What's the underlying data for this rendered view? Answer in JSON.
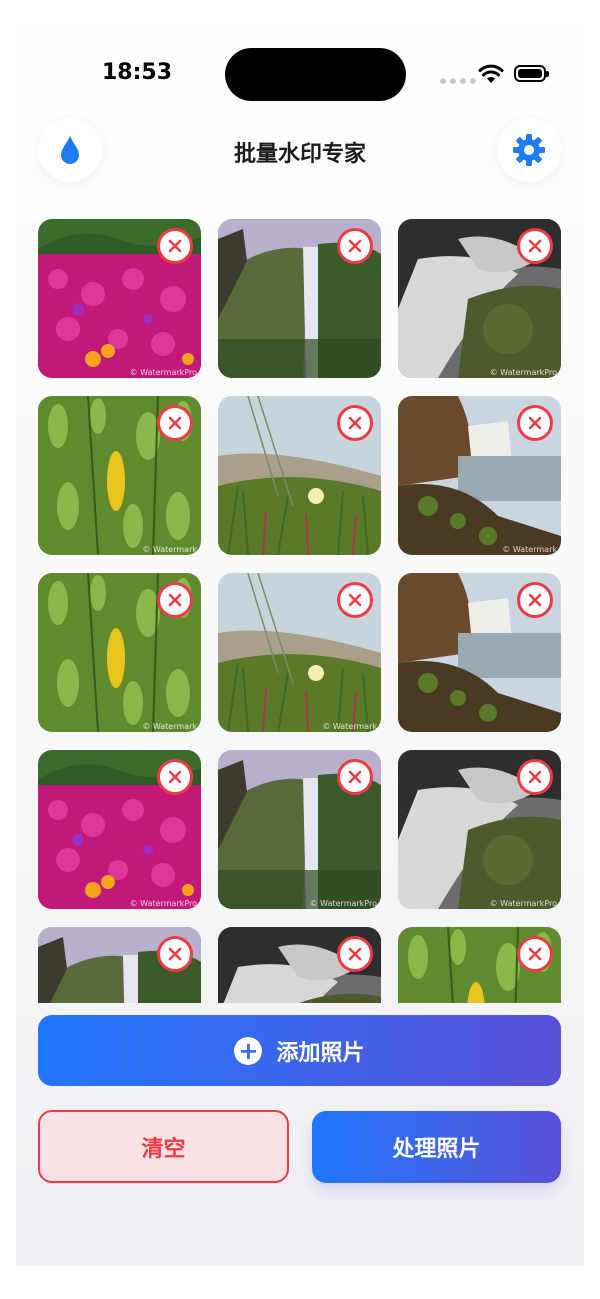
{
  "status": {
    "time": "18:53"
  },
  "header": {
    "title": "批量水印专家",
    "left_icon": "water-drop-icon",
    "right_icon": "gear-icon"
  },
  "colors": {
    "accent": "#2177ff",
    "accent_end": "#5851d6",
    "danger": "#ee3b43",
    "danger_bg": "#f9e1e4"
  },
  "grid": {
    "photos": [
      {
        "scene": "flowers",
        "watermark": "© WatermarkPro"
      },
      {
        "scene": "waterfall",
        "watermark": ""
      },
      {
        "scene": "river",
        "watermark": "© WatermarkPro"
      },
      {
        "scene": "leaves",
        "watermark": "© Watermark"
      },
      {
        "scene": "grass",
        "watermark": ""
      },
      {
        "scene": "cliff",
        "watermark": "© Watermark"
      },
      {
        "scene": "leaves",
        "watermark": "© Watermark"
      },
      {
        "scene": "grass",
        "watermark": "© Watermark"
      },
      {
        "scene": "cliff",
        "watermark": ""
      },
      {
        "scene": "flowers",
        "watermark": "© WatermarkPro"
      },
      {
        "scene": "waterfall",
        "watermark": "© WatermarkPro"
      },
      {
        "scene": "river",
        "watermark": "© WatermarkPro"
      },
      {
        "scene": "waterfall",
        "watermark": ""
      },
      {
        "scene": "river",
        "watermark": ""
      },
      {
        "scene": "leaves",
        "watermark": ""
      }
    ],
    "remove_icon": "close-icon"
  },
  "actions": {
    "add_label": "添加照片",
    "add_icon": "plus-circle-icon",
    "clear_label": "清空",
    "process_label": "处理照片"
  }
}
